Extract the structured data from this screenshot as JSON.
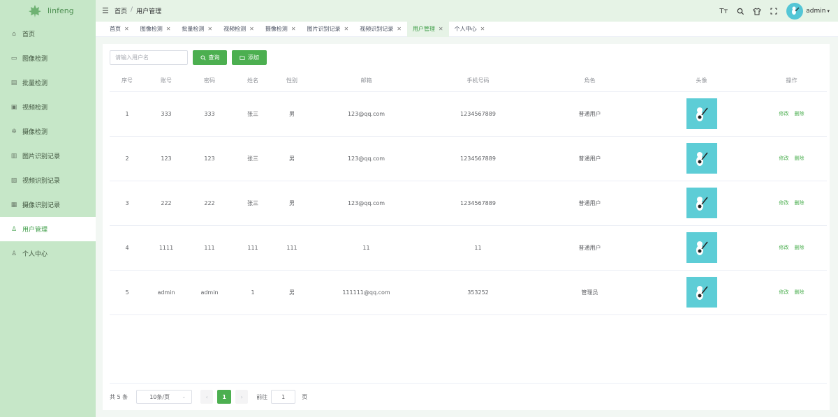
{
  "app": {
    "name": "linfeng"
  },
  "sidebar": {
    "items": [
      {
        "label": "首页",
        "icon": "home-icon"
      },
      {
        "label": "图像检测",
        "icon": "picture-icon"
      },
      {
        "label": "批量检测",
        "icon": "batch-icon"
      },
      {
        "label": "视频检测",
        "icon": "video-icon"
      },
      {
        "label": "摄像检测",
        "icon": "camera-icon"
      },
      {
        "label": "图片识别记录",
        "icon": "record-icon"
      },
      {
        "label": "视频识别记录",
        "icon": "doc-icon"
      },
      {
        "label": "摄像识别记录",
        "icon": "grid-icon"
      },
      {
        "label": "用户管理",
        "icon": "user-icon",
        "active": true
      },
      {
        "label": "个人中心",
        "icon": "person-icon"
      }
    ]
  },
  "header": {
    "breadcrumb": [
      "首页",
      "用户管理"
    ],
    "user_name": "admin"
  },
  "tabs": [
    {
      "label": "首页"
    },
    {
      "label": "图像检测"
    },
    {
      "label": "批量检测"
    },
    {
      "label": "视频检测"
    },
    {
      "label": "摄像检测"
    },
    {
      "label": "图片识别记录"
    },
    {
      "label": "视频识别记录"
    },
    {
      "label": "用户管理",
      "active": true
    },
    {
      "label": "个人中心"
    }
  ],
  "toolbar": {
    "search_placeholder": "请输入用户名",
    "query_label": "查询",
    "add_label": "添加"
  },
  "table": {
    "columns": [
      "序号",
      "账号",
      "密码",
      "姓名",
      "性别",
      "邮箱",
      "手机号码",
      "角色",
      "头像",
      "操作"
    ],
    "rows": [
      {
        "index": "1",
        "account": "333",
        "password": "333",
        "name": "张三",
        "gender": "男",
        "email": "123@qq.com",
        "phone": "1234567889",
        "role": "普通用户"
      },
      {
        "index": "2",
        "account": "123",
        "password": "123",
        "name": "张三",
        "gender": "男",
        "email": "123@qq.com",
        "phone": "1234567889",
        "role": "普通用户"
      },
      {
        "index": "3",
        "account": "222",
        "password": "222",
        "name": "张三",
        "gender": "男",
        "email": "123@qq.com",
        "phone": "1234567889",
        "role": "普通用户"
      },
      {
        "index": "4",
        "account": "1111",
        "password": "111",
        "name": "111",
        "gender": "111",
        "email": "11",
        "phone": "11",
        "role": "普通用户"
      },
      {
        "index": "5",
        "account": "admin",
        "password": "admin",
        "name": "1",
        "gender": "男",
        "email": "111111@qq.com",
        "phone": "353252",
        "role": "管理员"
      }
    ],
    "edit_label": "修改",
    "delete_label": "删除"
  },
  "pagination": {
    "total_label": "共 5 条",
    "page_size": "10条/页",
    "current_page": "1",
    "goto_prefix": "前往",
    "goto_value": "1",
    "goto_suffix": "页"
  },
  "colors": {
    "sidebar_bg": "#c6e7c8",
    "accent": "#4caf50",
    "avatar_bg": "#5dcdd6"
  }
}
